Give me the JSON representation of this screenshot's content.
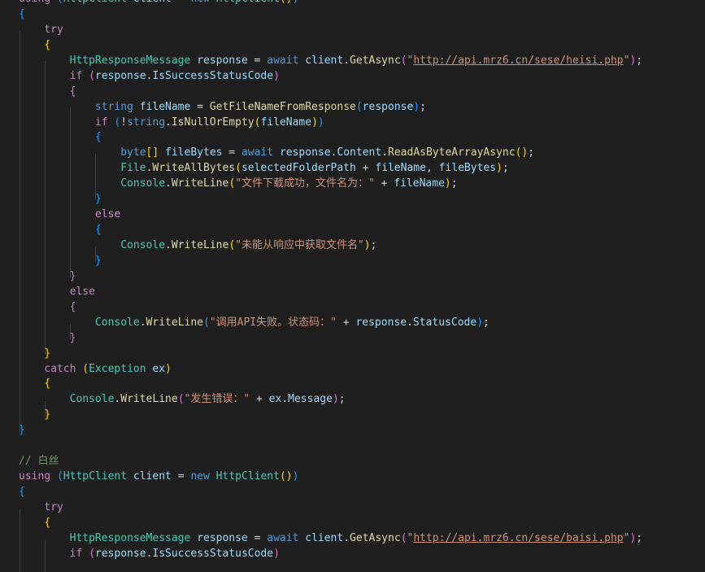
{
  "editor": {
    "lines": [
      [
        {
          "t": "using ",
          "c": "kw"
        },
        {
          "t": "(",
          "c": "b1"
        },
        {
          "t": "HttpClient",
          "c": "ty"
        },
        {
          "t": " ",
          "c": "pl"
        },
        {
          "t": "client",
          "c": "va"
        },
        {
          "t": " = ",
          "c": "pl"
        },
        {
          "t": "new",
          "c": "kwb"
        },
        {
          "t": " ",
          "c": "pl"
        },
        {
          "t": "HttpClient",
          "c": "ty"
        },
        {
          "t": "()",
          "c": "b2"
        },
        {
          "t": ")",
          "c": "b1"
        }
      ],
      [
        {
          "t": "{",
          "c": "b1"
        }
      ],
      [
        {
          "t": "    try",
          "c": "kw"
        }
      ],
      [
        {
          "t": "    ",
          "c": "pl"
        },
        {
          "t": "{",
          "c": "b2"
        }
      ],
      [
        {
          "t": "        ",
          "c": "pl"
        },
        {
          "t": "HttpResponseMessage",
          "c": "ty"
        },
        {
          "t": " ",
          "c": "pl"
        },
        {
          "t": "response",
          "c": "va"
        },
        {
          "t": " = ",
          "c": "pl"
        },
        {
          "t": "await",
          "c": "kwb"
        },
        {
          "t": " ",
          "c": "pl"
        },
        {
          "t": "client",
          "c": "va"
        },
        {
          "t": ".",
          "c": "pl"
        },
        {
          "t": "GetAsync",
          "c": "fn"
        },
        {
          "t": "(",
          "c": "b3"
        },
        {
          "t": "\"",
          "c": "st"
        },
        {
          "t": "http://api.mrz6.cn/sese/heisi.php",
          "c": "url"
        },
        {
          "t": "\"",
          "c": "st"
        },
        {
          "t": ")",
          "c": "b3"
        },
        {
          "t": ";",
          "c": "pl"
        }
      ],
      [
        {
          "t": "        if ",
          "c": "kw"
        },
        {
          "t": "(",
          "c": "b3"
        },
        {
          "t": "response",
          "c": "va"
        },
        {
          "t": ".",
          "c": "pl"
        },
        {
          "t": "IsSuccessStatusCode",
          "c": "va"
        },
        {
          "t": ")",
          "c": "b3"
        }
      ],
      [
        {
          "t": "        ",
          "c": "pl"
        },
        {
          "t": "{",
          "c": "b3"
        }
      ],
      [
        {
          "t": "            ",
          "c": "pl"
        },
        {
          "t": "string",
          "c": "kwb"
        },
        {
          "t": " ",
          "c": "pl"
        },
        {
          "t": "fileName",
          "c": "va"
        },
        {
          "t": " = ",
          "c": "pl"
        },
        {
          "t": "GetFileNameFromResponse",
          "c": "fn"
        },
        {
          "t": "(",
          "c": "b1"
        },
        {
          "t": "response",
          "c": "va"
        },
        {
          "t": ")",
          "c": "b1"
        },
        {
          "t": ";",
          "c": "pl"
        }
      ],
      [
        {
          "t": "            if ",
          "c": "kw"
        },
        {
          "t": "(",
          "c": "b1"
        },
        {
          "t": "!",
          "c": "pl"
        },
        {
          "t": "string",
          "c": "kwb"
        },
        {
          "t": ".",
          "c": "pl"
        },
        {
          "t": "IsNullOrEmpty",
          "c": "fn"
        },
        {
          "t": "(",
          "c": "b2"
        },
        {
          "t": "fileName",
          "c": "va"
        },
        {
          "t": ")",
          "c": "b2"
        },
        {
          "t": ")",
          "c": "b1"
        }
      ],
      [
        {
          "t": "            ",
          "c": "pl"
        },
        {
          "t": "{",
          "c": "b1"
        }
      ],
      [
        {
          "t": "                ",
          "c": "pl"
        },
        {
          "t": "byte",
          "c": "kwb"
        },
        {
          "t": "[]",
          "c": "b2"
        },
        {
          "t": " ",
          "c": "pl"
        },
        {
          "t": "fileBytes",
          "c": "va"
        },
        {
          "t": " = ",
          "c": "pl"
        },
        {
          "t": "await",
          "c": "kwb"
        },
        {
          "t": " ",
          "c": "pl"
        },
        {
          "t": "response",
          "c": "va"
        },
        {
          "t": ".",
          "c": "pl"
        },
        {
          "t": "Content",
          "c": "va"
        },
        {
          "t": ".",
          "c": "pl"
        },
        {
          "t": "ReadAsByteArrayAsync",
          "c": "fn"
        },
        {
          "t": "()",
          "c": "b2"
        },
        {
          "t": ";",
          "c": "pl"
        }
      ],
      [
        {
          "t": "                ",
          "c": "pl"
        },
        {
          "t": "File",
          "c": "ty"
        },
        {
          "t": ".",
          "c": "pl"
        },
        {
          "t": "WriteAllBytes",
          "c": "fn"
        },
        {
          "t": "(",
          "c": "b2"
        },
        {
          "t": "selectedFolderPath",
          "c": "va"
        },
        {
          "t": " + ",
          "c": "pl"
        },
        {
          "t": "fileName",
          "c": "va"
        },
        {
          "t": ", ",
          "c": "pl"
        },
        {
          "t": "fileBytes",
          "c": "va"
        },
        {
          "t": ")",
          "c": "b2"
        },
        {
          "t": ";",
          "c": "pl"
        }
      ],
      [
        {
          "t": "                ",
          "c": "pl"
        },
        {
          "t": "Console",
          "c": "ty"
        },
        {
          "t": ".",
          "c": "pl"
        },
        {
          "t": "WriteLine",
          "c": "fn"
        },
        {
          "t": "(",
          "c": "b2"
        },
        {
          "t": "\"文件下载成功，文件名为：\"",
          "c": "st"
        },
        {
          "t": " + ",
          "c": "pl"
        },
        {
          "t": "fileName",
          "c": "va"
        },
        {
          "t": ")",
          "c": "b2"
        },
        {
          "t": ";",
          "c": "pl"
        }
      ],
      [
        {
          "t": "            ",
          "c": "pl"
        },
        {
          "t": "}",
          "c": "b1"
        }
      ],
      [
        {
          "t": "            else",
          "c": "kw"
        }
      ],
      [
        {
          "t": "            ",
          "c": "pl"
        },
        {
          "t": "{",
          "c": "b1"
        }
      ],
      [
        {
          "t": "                ",
          "c": "pl"
        },
        {
          "t": "Console",
          "c": "ty"
        },
        {
          "t": ".",
          "c": "pl"
        },
        {
          "t": "WriteLine",
          "c": "fn"
        },
        {
          "t": "(",
          "c": "b2"
        },
        {
          "t": "\"未能从响应中获取文件名\"",
          "c": "st"
        },
        {
          "t": ")",
          "c": "b2"
        },
        {
          "t": ";",
          "c": "pl"
        }
      ],
      [
        {
          "t": "            ",
          "c": "pl"
        },
        {
          "t": "}",
          "c": "b1"
        }
      ],
      [
        {
          "t": "        ",
          "c": "pl"
        },
        {
          "t": "}",
          "c": "b3"
        }
      ],
      [
        {
          "t": "        else",
          "c": "kw"
        }
      ],
      [
        {
          "t": "        ",
          "c": "pl"
        },
        {
          "t": "{",
          "c": "b3"
        }
      ],
      [
        {
          "t": "            ",
          "c": "pl"
        },
        {
          "t": "Console",
          "c": "ty"
        },
        {
          "t": ".",
          "c": "pl"
        },
        {
          "t": "WriteLine",
          "c": "fn"
        },
        {
          "t": "(",
          "c": "b1"
        },
        {
          "t": "\"调用API失败。状态码：\"",
          "c": "st"
        },
        {
          "t": " + ",
          "c": "pl"
        },
        {
          "t": "response",
          "c": "va"
        },
        {
          "t": ".",
          "c": "pl"
        },
        {
          "t": "StatusCode",
          "c": "va"
        },
        {
          "t": ")",
          "c": "b1"
        },
        {
          "t": ";",
          "c": "pl"
        }
      ],
      [
        {
          "t": "        ",
          "c": "pl"
        },
        {
          "t": "}",
          "c": "b3"
        }
      ],
      [
        {
          "t": "    ",
          "c": "pl"
        },
        {
          "t": "}",
          "c": "b2"
        }
      ],
      [
        {
          "t": "    catch ",
          "c": "kw"
        },
        {
          "t": "(",
          "c": "b2"
        },
        {
          "t": "Exception",
          "c": "ty"
        },
        {
          "t": " ",
          "c": "pl"
        },
        {
          "t": "ex",
          "c": "va"
        },
        {
          "t": ")",
          "c": "b2"
        }
      ],
      [
        {
          "t": "    ",
          "c": "pl"
        },
        {
          "t": "{",
          "c": "b2"
        }
      ],
      [
        {
          "t": "        ",
          "c": "pl"
        },
        {
          "t": "Console",
          "c": "ty"
        },
        {
          "t": ".",
          "c": "pl"
        },
        {
          "t": "WriteLine",
          "c": "fn"
        },
        {
          "t": "(",
          "c": "b3"
        },
        {
          "t": "\"发生错误：\"",
          "c": "st"
        },
        {
          "t": " + ",
          "c": "pl"
        },
        {
          "t": "ex",
          "c": "va"
        },
        {
          "t": ".",
          "c": "pl"
        },
        {
          "t": "Message",
          "c": "va"
        },
        {
          "t": ")",
          "c": "b3"
        },
        {
          "t": ";",
          "c": "pl"
        }
      ],
      [
        {
          "t": "    ",
          "c": "pl"
        },
        {
          "t": "}",
          "c": "b2"
        }
      ],
      [
        {
          "t": "}",
          "c": "b1"
        }
      ],
      [],
      [
        {
          "t": "// 白丝",
          "c": "cm"
        }
      ],
      [
        {
          "t": "using ",
          "c": "kw"
        },
        {
          "t": "(",
          "c": "b1"
        },
        {
          "t": "HttpClient",
          "c": "ty"
        },
        {
          "t": " ",
          "c": "pl"
        },
        {
          "t": "client",
          "c": "va"
        },
        {
          "t": " = ",
          "c": "pl"
        },
        {
          "t": "new",
          "c": "kwb"
        },
        {
          "t": " ",
          "c": "pl"
        },
        {
          "t": "HttpClient",
          "c": "ty"
        },
        {
          "t": "()",
          "c": "b2"
        },
        {
          "t": ")",
          "c": "b1"
        }
      ],
      [
        {
          "t": "{",
          "c": "b1"
        }
      ],
      [
        {
          "t": "    try",
          "c": "kw"
        }
      ],
      [
        {
          "t": "    ",
          "c": "pl"
        },
        {
          "t": "{",
          "c": "b2"
        }
      ],
      [
        {
          "t": "        ",
          "c": "pl"
        },
        {
          "t": "HttpResponseMessage",
          "c": "ty"
        },
        {
          "t": " ",
          "c": "pl"
        },
        {
          "t": "response",
          "c": "va"
        },
        {
          "t": " = ",
          "c": "pl"
        },
        {
          "t": "await",
          "c": "kwb"
        },
        {
          "t": " ",
          "c": "pl"
        },
        {
          "t": "client",
          "c": "va"
        },
        {
          "t": ".",
          "c": "pl"
        },
        {
          "t": "GetAsync",
          "c": "fn"
        },
        {
          "t": "(",
          "c": "b3"
        },
        {
          "t": "\"",
          "c": "st"
        },
        {
          "t": "http://api.mrz6.cn/sese/baisi.php",
          "c": "url"
        },
        {
          "t": "\"",
          "c": "st"
        },
        {
          "t": ")",
          "c": "b3"
        },
        {
          "t": ";",
          "c": "pl"
        }
      ],
      [
        {
          "t": "        if ",
          "c": "kw"
        },
        {
          "t": "(",
          "c": "b3"
        },
        {
          "t": "response",
          "c": "va"
        },
        {
          "t": ".",
          "c": "pl"
        },
        {
          "t": "IsSuccessStatusCode",
          "c": "va"
        },
        {
          "t": ")",
          "c": "b3"
        }
      ]
    ]
  }
}
